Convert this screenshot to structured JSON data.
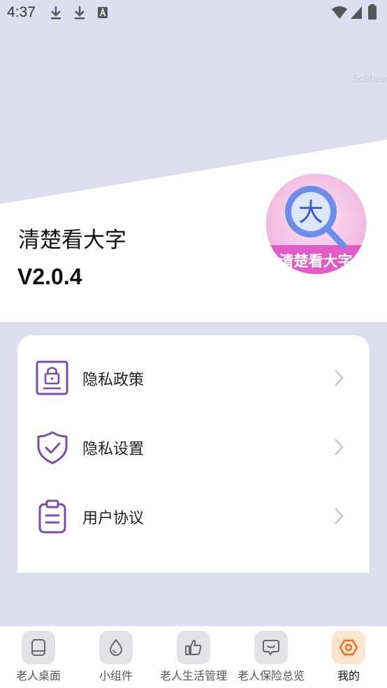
{
  "status": {
    "time": "4:37",
    "icons": [
      "download-icon",
      "download-icon",
      "font-icon",
      "wifi-icon",
      "signal-icon",
      "battery-icon"
    ]
  },
  "hash": "5c9bee",
  "app": {
    "name": "清楚看大字",
    "version": "V2.0.4",
    "logo_text": "清楚看大字",
    "logo_char": "大"
  },
  "menu": {
    "items": [
      {
        "label": "隐私政策",
        "icon": "privacy-policy-icon"
      },
      {
        "label": "隐私设置",
        "icon": "shield-check-icon"
      },
      {
        "label": "用户协议",
        "icon": "clipboard-icon"
      }
    ]
  },
  "tabs": [
    {
      "label": "老人桌面",
      "icon": "tablet-icon",
      "active": false
    },
    {
      "label": "小组件",
      "icon": "drop-icon",
      "active": false
    },
    {
      "label": "老人生活管理",
      "icon": "thumbs-up-icon",
      "active": false
    },
    {
      "label": "老人保险总览",
      "icon": "chat-smile-icon",
      "active": false
    },
    {
      "label": "我的",
      "icon": "hexagon-icon",
      "active": true
    }
  ],
  "colors": {
    "background": "#dfdef0",
    "menu_icon_purple": "#7a4fa8",
    "active_tab_accent": "#ef6c1a",
    "active_tab_bg": "#fde4cf"
  }
}
